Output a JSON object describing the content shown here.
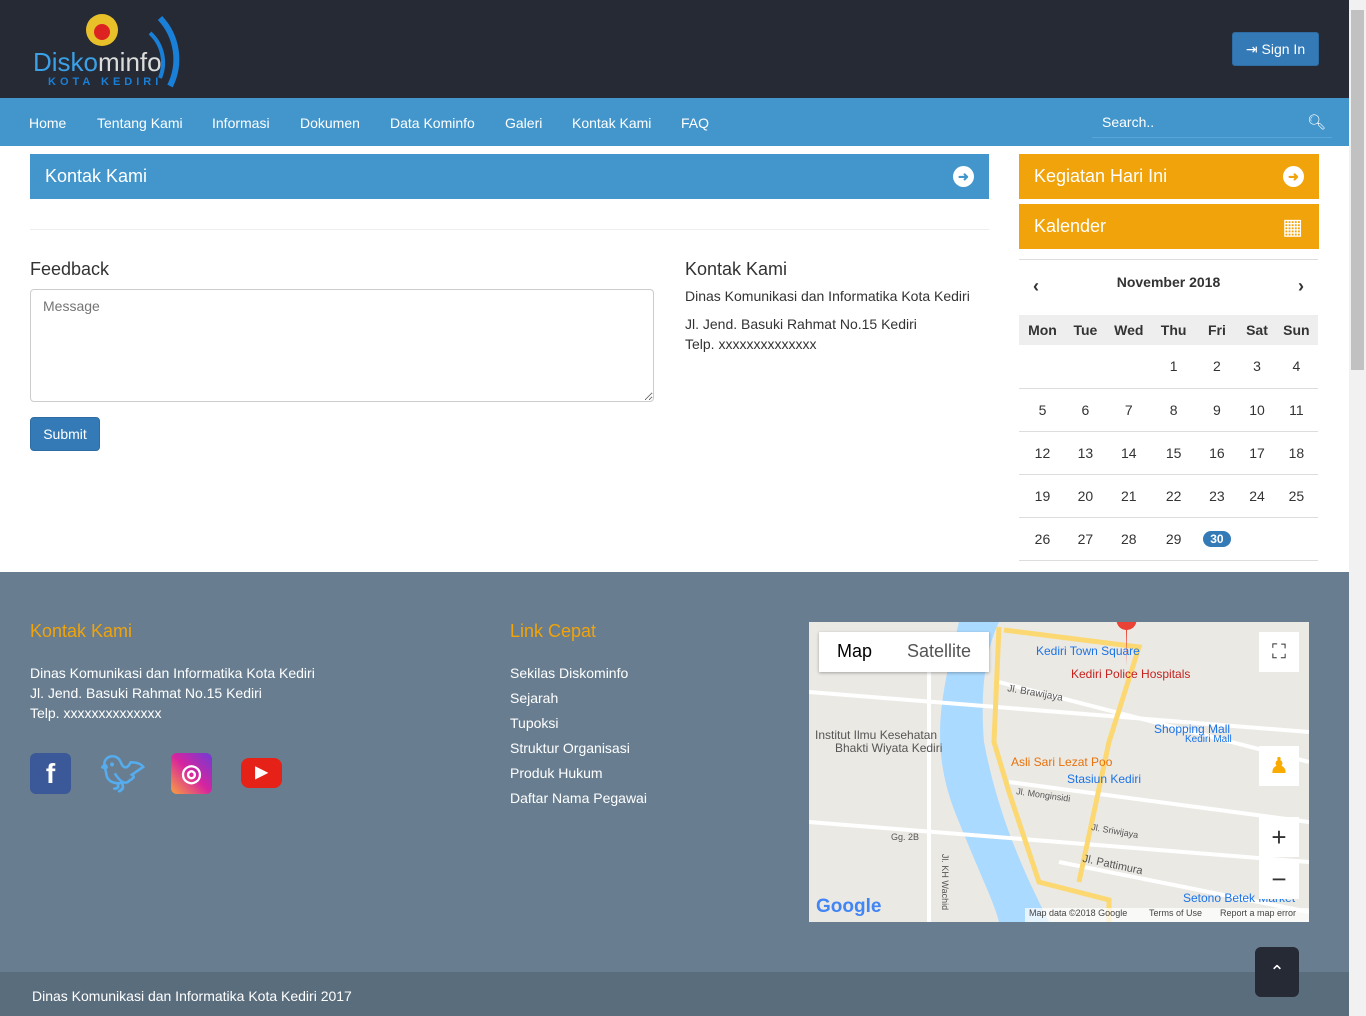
{
  "header": {
    "logo_text": "Diskominfo",
    "logo_sub": "KOTA KEDIRI",
    "signin": "Sign In"
  },
  "nav": {
    "items": [
      "Home",
      "Tentang Kami",
      "Informasi",
      "Dokumen",
      "Data Kominfo",
      "Galeri",
      "Kontak Kami",
      "FAQ"
    ],
    "search_placeholder": "Search.."
  },
  "main": {
    "panel_title": "Kontak Kami",
    "feedback_title": "Feedback",
    "message_placeholder": "Message",
    "submit": "Submit",
    "contact_title": "Kontak Kami",
    "contact_name": "Dinas Komunikasi dan Informatika Kota Kediri",
    "address": "Jl. Jend. Basuki Rahmat No.15 Kediri",
    "phone": "Telp. xxxxxxxxxxxxxx"
  },
  "sidebar": {
    "today_title": "Kegiatan Hari Ini",
    "calendar_title": "Kalender",
    "month": "November 2018",
    "days": [
      "Mon",
      "Tue",
      "Wed",
      "Thu",
      "Fri",
      "Sat",
      "Sun"
    ],
    "weeks": [
      [
        "",
        "",
        "",
        "1",
        "2",
        "3",
        "4"
      ],
      [
        "5",
        "6",
        "7",
        "8",
        "9",
        "10",
        "11"
      ],
      [
        "12",
        "13",
        "14",
        "15",
        "16",
        "17",
        "18"
      ],
      [
        "19",
        "20",
        "21",
        "22",
        "23",
        "24",
        "25"
      ],
      [
        "26",
        "27",
        "28",
        "29",
        "30",
        "",
        ""
      ]
    ],
    "today": "30"
  },
  "footer": {
    "contact_title": "Kontak Kami",
    "contact_name": "Dinas Komunikasi dan Informatika Kota Kediri",
    "address": "Jl. Jend. Basuki Rahmat No.15 Kediri",
    "phone": "Telp. xxxxxxxxxxxxxx",
    "links_title": "Link Cepat",
    "links": [
      "Sekilas Diskominfo",
      "Sejarah",
      "Tupoksi",
      "Struktur Organisasi",
      "Produk Hukum",
      "Daftar Nama Pegawai"
    ],
    "copyright": "Dinas Komunikasi dan Informatika Kota Kediri 2017"
  },
  "map": {
    "tab_map": "Map",
    "tab_satellite": "Satellite",
    "labels": [
      "Kediri Town Square",
      "Kediri Police Hospitals",
      "Jl. Brawijaya",
      "Shopping Mall",
      "Kediri Mall",
      "Institut Ilmu Kesehatan",
      "Bhakti Wiyata Kediri",
      "Asli Sari Lezat Poo",
      "Stasiun Kediri",
      "Jl. Monginsidi",
      "Jl. Sriwijaya",
      "Jl. Pattimura",
      "Setono Betek Market",
      "Jl. KH Wachid",
      "Gg. 2B"
    ],
    "attribution": "Map data ©2018 Google",
    "terms": "Terms of Use",
    "report": "Report a map error",
    "google": "Google"
  },
  "colors": {
    "header": "#262a35",
    "nav": "#4296cc",
    "accent": "#f0a30a",
    "footer": "#687e90"
  }
}
